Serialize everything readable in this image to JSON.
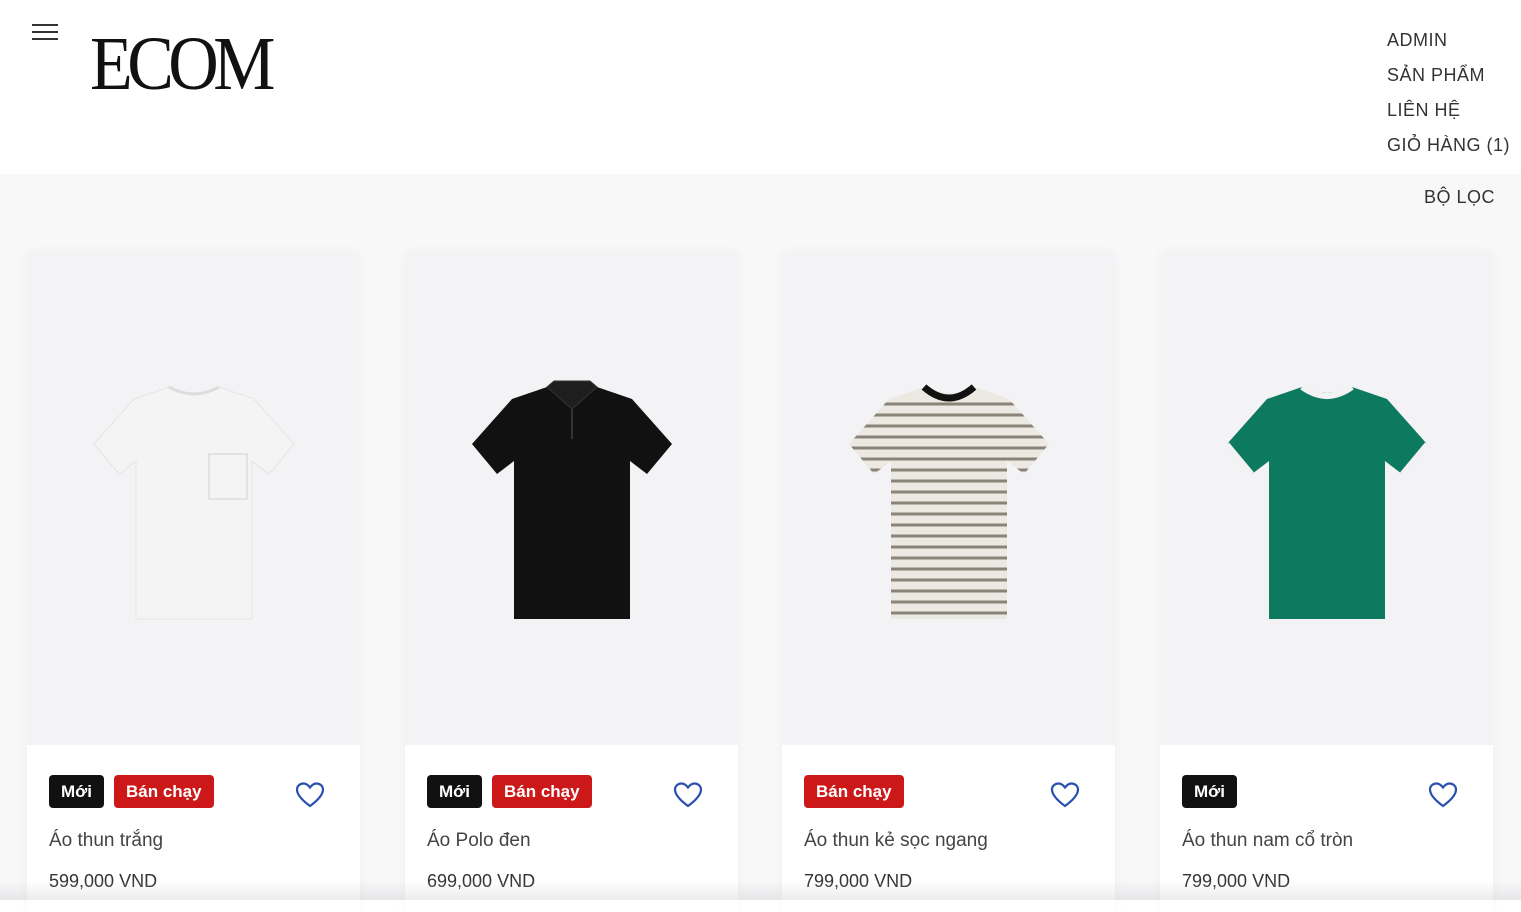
{
  "header": {
    "logo": "ECOM",
    "nav": [
      {
        "label": "ADMIN"
      },
      {
        "label": "SẢN PHẨM"
      },
      {
        "label": "LIÊN HỆ"
      },
      {
        "label": "GIỎ HÀNG (1)"
      }
    ]
  },
  "toolbar": {
    "filter_label": "BỘ LỌC"
  },
  "products": [
    {
      "name": "Áo thun trắng",
      "price": "599,000 VND",
      "badges": [
        "Mới",
        "Bán chạy"
      ],
      "shirt_color": "#f4f4f4",
      "style": "pocket-tee"
    },
    {
      "name": "Áo Polo đen",
      "price": "699,000 VND",
      "badges": [
        "Mới",
        "Bán chạy"
      ],
      "shirt_color": "#111111",
      "style": "polo"
    },
    {
      "name": "Áo thun kẻ sọc ngang",
      "price": "799,000 VND",
      "badges": [
        "Bán chạy"
      ],
      "shirt_color": "#ece9e2",
      "style": "striped-tee"
    },
    {
      "name": "Áo thun nam cổ tròn",
      "price": "799,000 VND",
      "badges": [
        "Mới"
      ],
      "shirt_color": "#0d7a5f",
      "style": "ringer-tee"
    }
  ],
  "colors": {
    "badge_new": "#111111",
    "badge_hot": "#cc1818",
    "heart": "#2a4fb0"
  }
}
